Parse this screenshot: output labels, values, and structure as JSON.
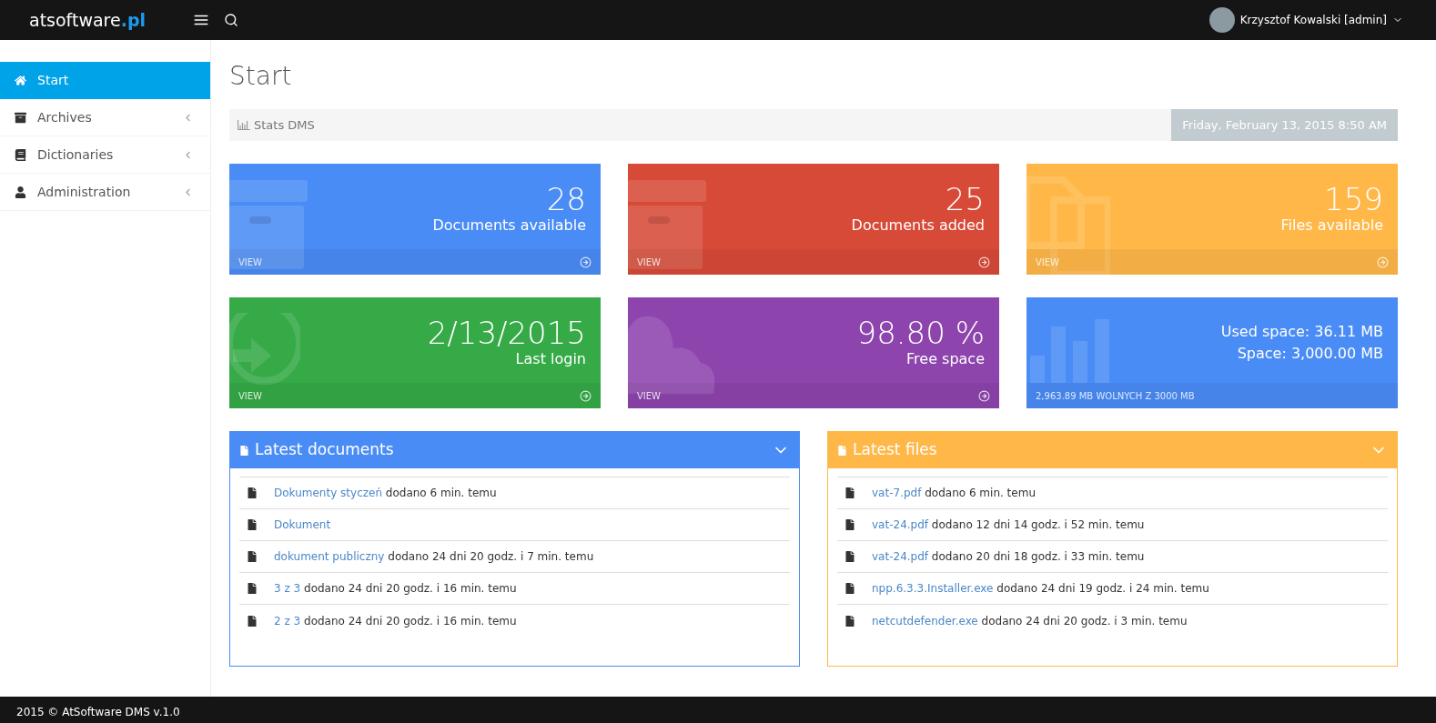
{
  "header": {
    "logo": {
      "text": "atsoftware",
      "accent": ".pl"
    },
    "user": {
      "name": "Krzysztof Kowalski [admin]"
    }
  },
  "sidebar": {
    "items": [
      {
        "label": "Start",
        "selected": true,
        "expandable": false
      },
      {
        "label": "Archives",
        "selected": false,
        "expandable": true
      },
      {
        "label": "Dictionaries",
        "selected": false,
        "expandable": true
      },
      {
        "label": "Administration",
        "selected": false,
        "expandable": true
      }
    ]
  },
  "page": {
    "title": "Start",
    "stats_bar": {
      "label": "Stats DMS",
      "date": "Friday, February 13, 2015 8:50 AM"
    }
  },
  "tiles": [
    {
      "kind": "archive",
      "color": "#4a8cf6",
      "lines": [
        "28"
      ],
      "label": "Documents available",
      "footer": "VIEW",
      "arrow": true
    },
    {
      "kind": "archive",
      "color": "#d84a38",
      "lines": [
        "25"
      ],
      "label": "Documents added",
      "footer": "VIEW",
      "arrow": true
    },
    {
      "kind": "files",
      "color": "#ffb848",
      "lines": [
        "159"
      ],
      "label": "Files available",
      "footer": "VIEW",
      "arrow": true
    },
    {
      "kind": "login",
      "color": "#35aa47",
      "lines": [
        "2/13/2015"
      ],
      "label": "Last login",
      "footer": "VIEW",
      "arrow": true
    },
    {
      "kind": "cloud",
      "color": "#8e44ad",
      "lines": [
        "98.80 %"
      ],
      "label": "Free space",
      "footer": "VIEW",
      "arrow": true
    },
    {
      "kind": "chart",
      "color": "#4a8cf6",
      "lines": [
        "Used space: 36.11 MB",
        "Space: 3,000.00 MB"
      ],
      "footer": "2,963.89 MB WOLNYCH Z 3000 MB",
      "arrow": false
    }
  ],
  "panels": [
    {
      "title": "Latest documents",
      "color": "#4a8cf6",
      "items": [
        {
          "link": "Dokumenty styczeń",
          "text": "dodano 6 min. temu"
        },
        {
          "link": "Dokument"
        },
        {
          "link": "dokument publiczny",
          "text": "dodano 24 dni 20 godz. i 7 min. temu"
        },
        {
          "link": "3 z 3",
          "text": "dodano 24 dni 20 godz. i 16 min. temu"
        },
        {
          "link": "2 z 3",
          "text": "dodano 24 dni 20 godz. i 16 min. temu"
        }
      ]
    },
    {
      "title": "Latest files",
      "color": "#ffb848",
      "items": [
        {
          "link": "vat-7.pdf",
          "text": "dodano 6 min. temu"
        },
        {
          "link": "vat-24.pdf",
          "text": "dodano 12 dni 14 godz. i 52 min. temu"
        },
        {
          "link": "vat-24.pdf",
          "text": "dodano 20 dni 18 godz. i 33 min. temu"
        },
        {
          "link": "npp.6.3.3.Installer.exe",
          "text": "dodano 24 dni 19 godz. i 24 min. temu"
        },
        {
          "link": "netcutdefender.exe",
          "text": "dodano 24 dni 20 godz. i 3 min. temu"
        }
      ]
    }
  ],
  "footer": {
    "text": "2015 © AtSoftware DMS v.1.0"
  }
}
